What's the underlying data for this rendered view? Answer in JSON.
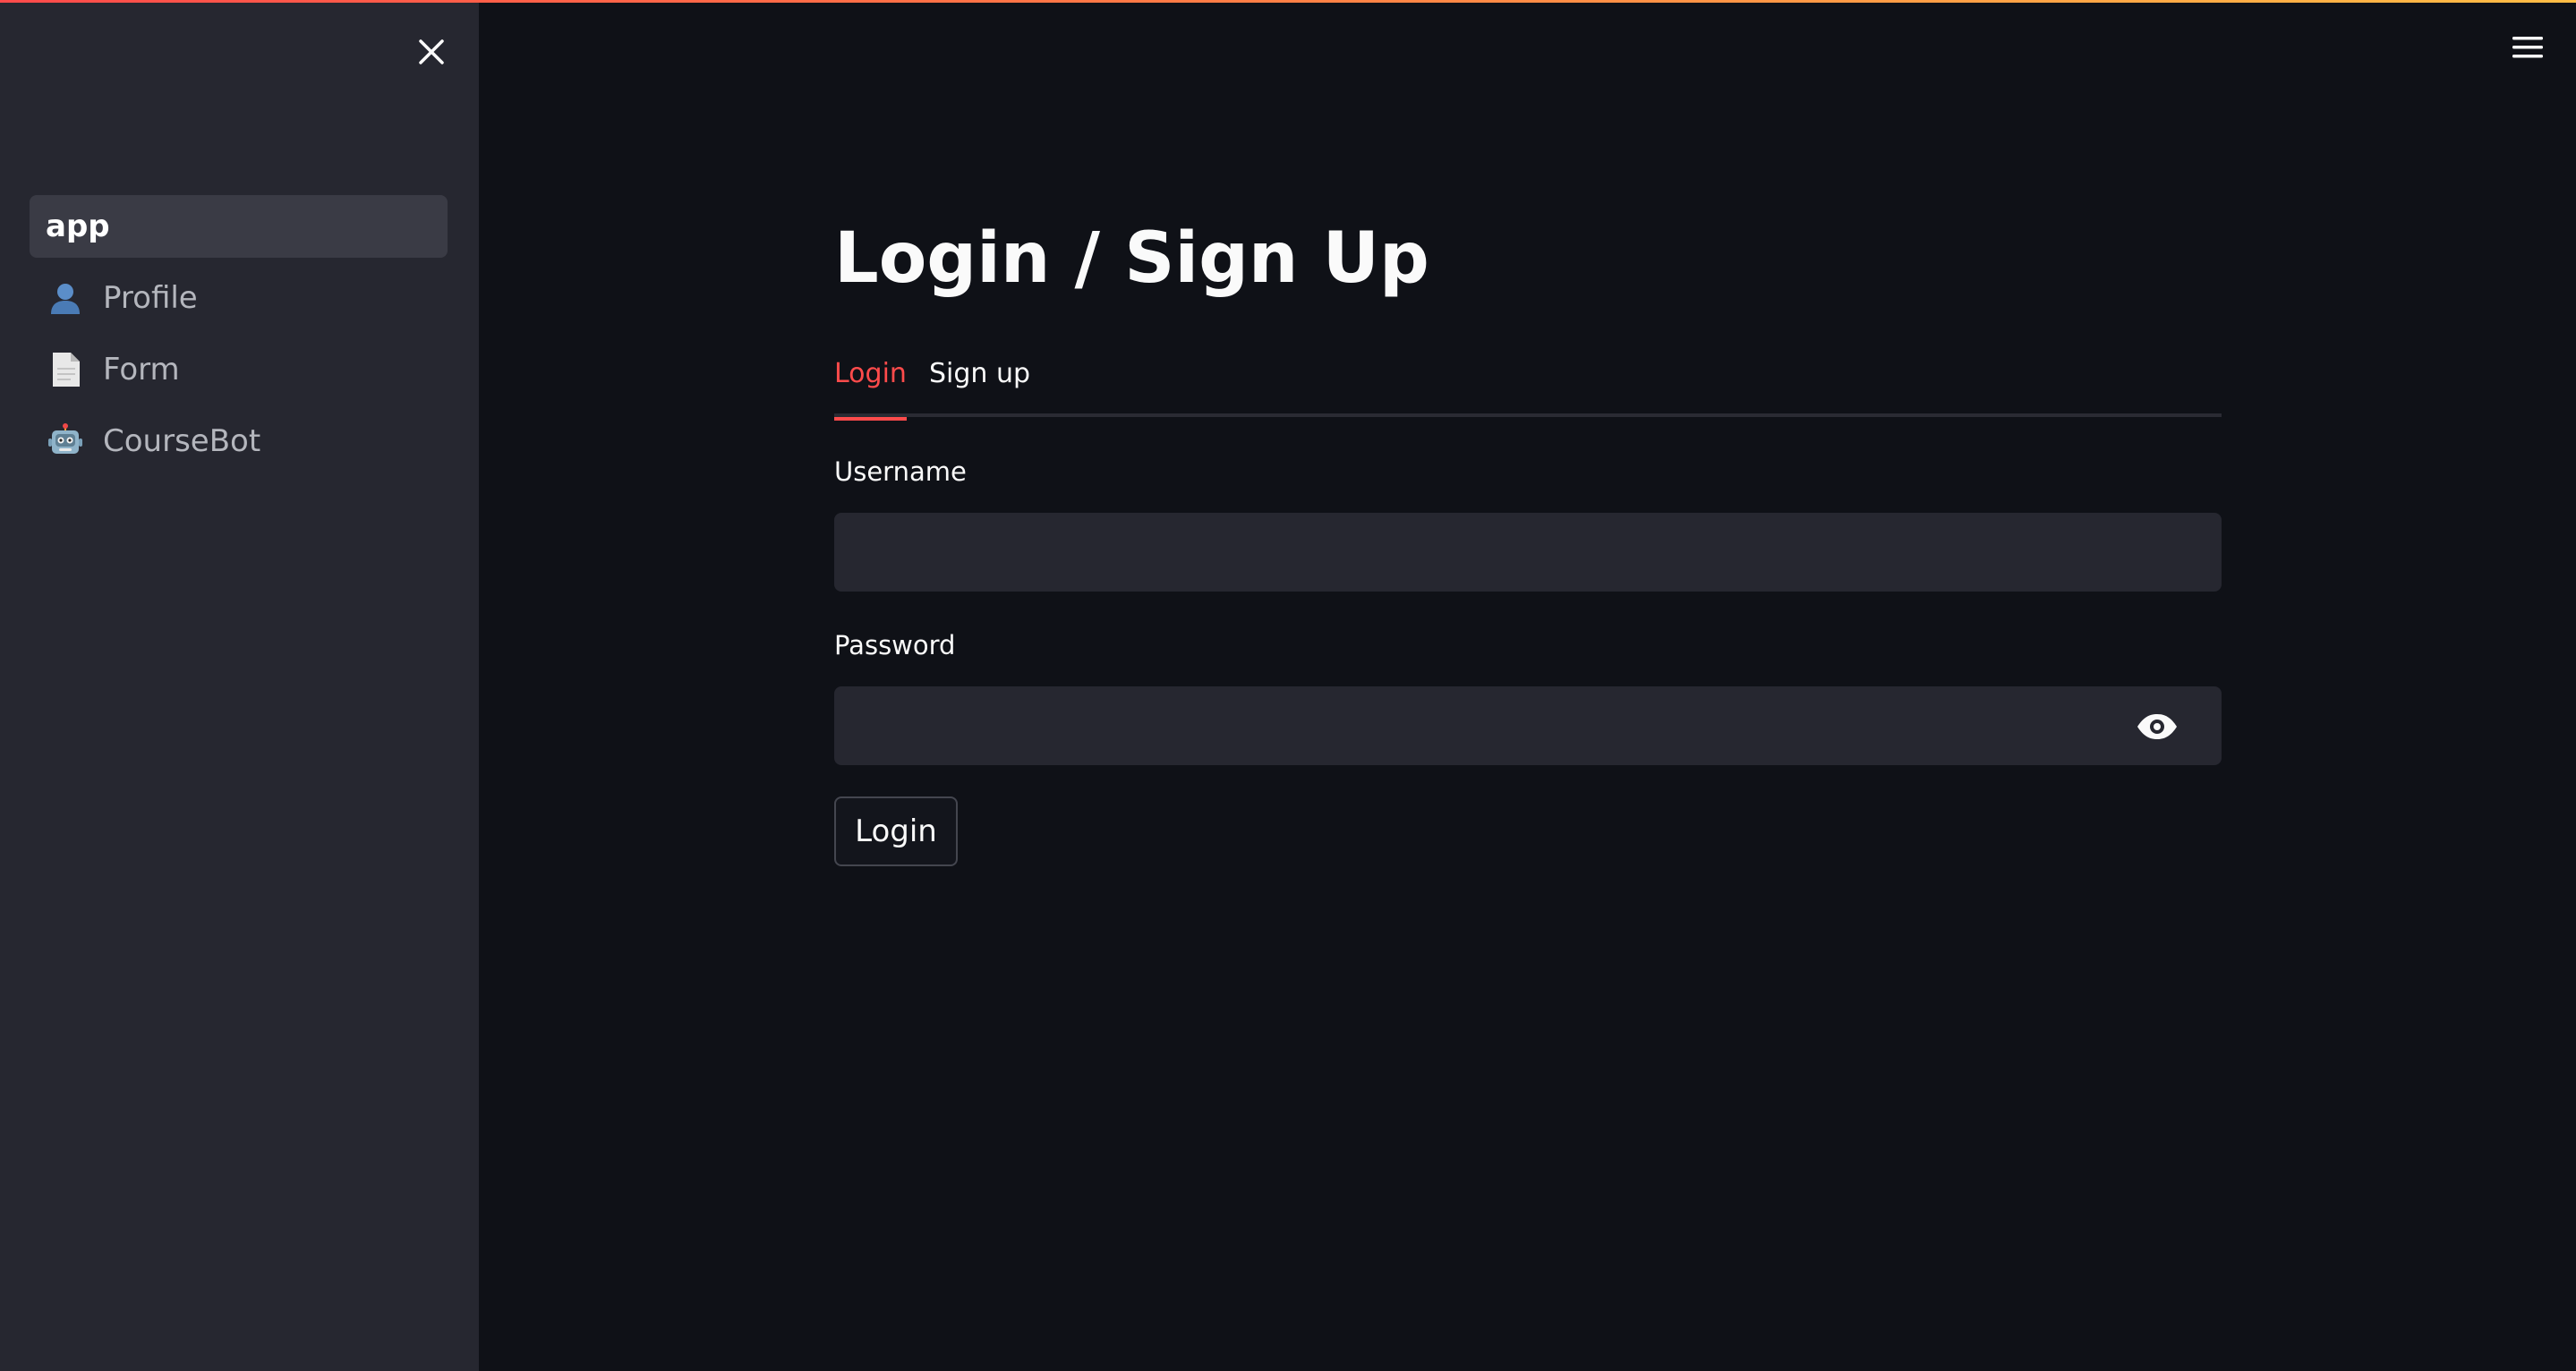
{
  "sidebar": {
    "close_icon": "close-icon",
    "items": [
      {
        "label": "app",
        "icon": "",
        "active": true
      },
      {
        "label": "Profile",
        "icon": "person-silhouette-icon",
        "active": false
      },
      {
        "label": "Form",
        "icon": "page-facing-up-icon",
        "active": false
      },
      {
        "label": "CourseBot",
        "icon": "robot-icon",
        "active": false
      }
    ]
  },
  "header": {
    "menu_icon": "hamburger-menu-icon"
  },
  "main": {
    "title": "Login / Sign Up",
    "tabs": [
      {
        "label": "Login",
        "active": true
      },
      {
        "label": "Sign up",
        "active": false
      }
    ],
    "form": {
      "username_label": "Username",
      "username_value": "",
      "password_label": "Password",
      "password_value": "",
      "password_toggle_icon": "eye-icon",
      "submit_label": "Login"
    }
  },
  "colors": {
    "accent": "#ff4b4b",
    "background": "#0f1117",
    "sidebar": "#262730",
    "input": "#262730"
  }
}
